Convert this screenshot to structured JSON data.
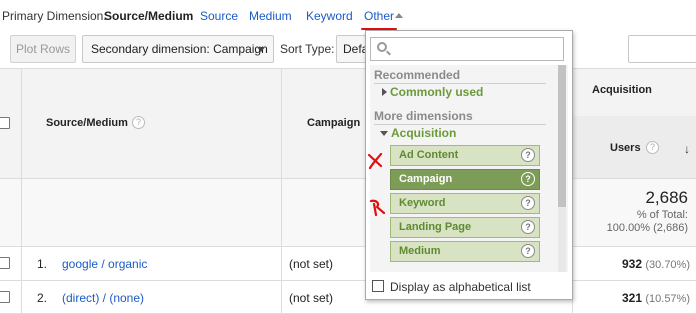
{
  "primary_dimension": {
    "label": "Primary Dimension:",
    "current": "Source/Medium",
    "links": [
      "Source",
      "Medium",
      "Keyword"
    ],
    "other_label": "Other"
  },
  "toolbar": {
    "plot_rows": "Plot Rows",
    "secondary_dimension": "Secondary dimension: Campaign",
    "sort_type_label": "Sort Type:",
    "sort_type_value": "Defa"
  },
  "table": {
    "col_source_medium": "Source/Medium",
    "col_campaign": "Campaign",
    "col_acquisition": "Acquisition",
    "col_users": "Users",
    "total_users": "2,686",
    "total_pct_label": "% of Total:",
    "total_pct_value": "100.00% (2,686)",
    "rows": [
      {
        "num": "1.",
        "source": "google / organic",
        "campaign": "(not set)",
        "users": "932",
        "pct": "(30.70%)"
      },
      {
        "num": "2.",
        "source": "(direct) / (none)",
        "campaign": "(not set)",
        "users": "321",
        "pct": "(10.57%)"
      }
    ]
  },
  "popup": {
    "search_placeholder": "",
    "recommended_heading": "Recommended",
    "commonly_used": "Commonly used",
    "more_dimensions_heading": "More dimensions",
    "acquisition_group": "Acquisition",
    "items": [
      {
        "label": "Ad Content",
        "selected": false
      },
      {
        "label": "Campaign",
        "selected": true
      },
      {
        "label": "Keyword",
        "selected": false
      },
      {
        "label": "Landing Page",
        "selected": false
      },
      {
        "label": "Medium",
        "selected": false
      }
    ],
    "alphabetical_label": "Display as alphabetical list"
  },
  "colors": {
    "link": "#1a5cc8",
    "accent_red": "#e01010",
    "dim_item_bg": "#d7e3c2",
    "dim_item_selected_bg": "#7d9c57",
    "group_green": "#6a9a3a"
  },
  "icons": [
    "help-icon",
    "search-icon",
    "sort-down-arrow-icon",
    "caret-up-icon",
    "caret-down-icon",
    "expand-right-icon",
    "collapse-down-icon"
  ]
}
